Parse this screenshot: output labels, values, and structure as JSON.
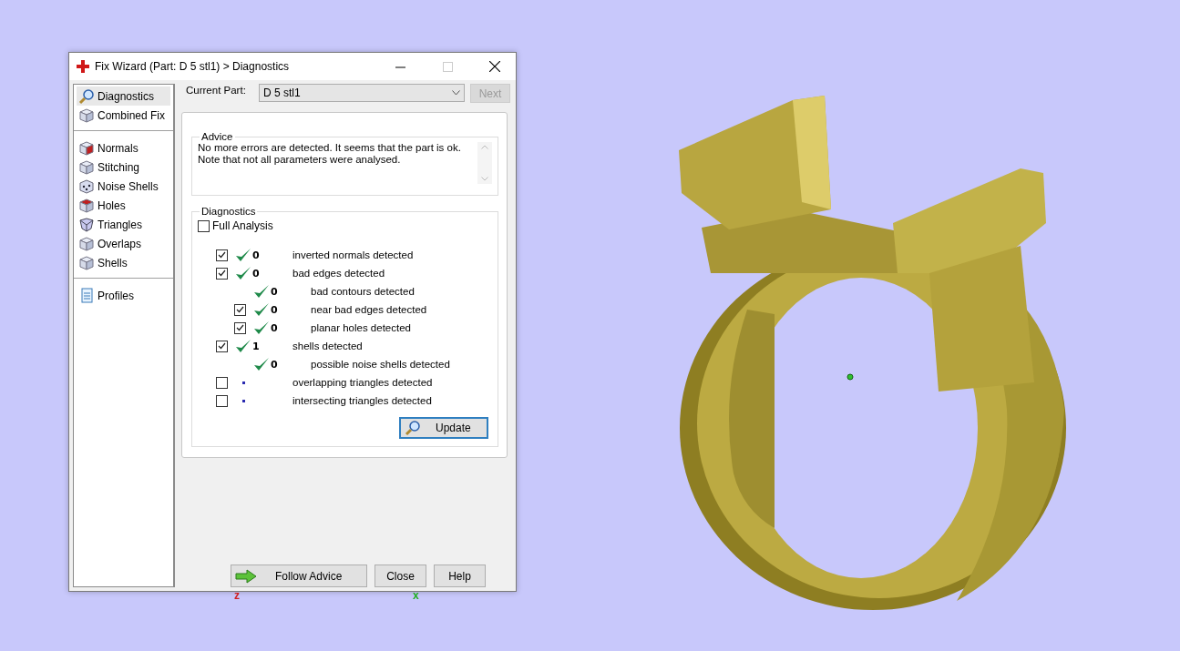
{
  "window": {
    "title": "Fix Wizard (Part: D 5 stl1) > Diagnostics"
  },
  "sidebar": {
    "groups": [
      {
        "items": [
          {
            "label": "Diagnostics",
            "selected": true
          },
          {
            "label": "Combined Fix",
            "selected": false
          }
        ]
      },
      {
        "items": [
          {
            "label": "Normals",
            "selected": false
          },
          {
            "label": "Stitching",
            "selected": false
          },
          {
            "label": "Noise Shells",
            "selected": false
          },
          {
            "label": "Holes",
            "selected": false
          },
          {
            "label": "Triangles",
            "selected": false
          },
          {
            "label": "Overlaps",
            "selected": false
          },
          {
            "label": "Shells",
            "selected": false
          }
        ]
      },
      {
        "items": [
          {
            "label": "Profiles",
            "selected": false
          }
        ]
      }
    ]
  },
  "current_part": {
    "label": "Current Part:",
    "value": "D 5 stl1",
    "next_button": {
      "label": "Next",
      "disabled": true
    }
  },
  "advice": {
    "title": "Advice",
    "lines": [
      "No more errors are detected. It seems that the part is ok.",
      "Note that not all parameters were analysed."
    ]
  },
  "diagnostics": {
    "title": "Diagnostics",
    "full_analysis": {
      "label": "Full Analysis",
      "checked": false
    },
    "items": [
      {
        "kind": "checkbox",
        "checked": true,
        "analysed": true,
        "count": "0",
        "label": "inverted normals detected"
      },
      {
        "kind": "checkbox",
        "checked": true,
        "analysed": true,
        "count": "0",
        "label": "bad edges detected",
        "children": [
          {
            "kind": "plain",
            "analysed": true,
            "count": "0",
            "label": "bad contours detected"
          },
          {
            "kind": "checkbox",
            "checked": true,
            "analysed": true,
            "count": "0",
            "label": "near bad edges detected"
          },
          {
            "kind": "checkbox",
            "checked": true,
            "analysed": true,
            "count": "0",
            "label": "planar holes detected"
          }
        ]
      },
      {
        "kind": "checkbox",
        "checked": true,
        "analysed": true,
        "count": "1",
        "label": "shells detected",
        "children": [
          {
            "kind": "plain",
            "analysed": true,
            "count": "0",
            "label": "possible noise shells detected"
          }
        ]
      },
      {
        "kind": "checkbox",
        "checked": false,
        "analysed": false,
        "label": "overlapping triangles detected"
      },
      {
        "kind": "checkbox",
        "checked": false,
        "analysed": false,
        "label": "intersecting triangles detected"
      }
    ],
    "update_button": "Update"
  },
  "buttons": [
    {
      "kind": "follow",
      "label": "Follow Advice"
    },
    {
      "kind": "plain",
      "label": "Close"
    },
    {
      "kind": "plain",
      "label": "Help"
    }
  ],
  "axis_labels": [
    {
      "label": "z",
      "color": "#d02020"
    },
    {
      "label": "x",
      "color": "#20b020"
    }
  ]
}
